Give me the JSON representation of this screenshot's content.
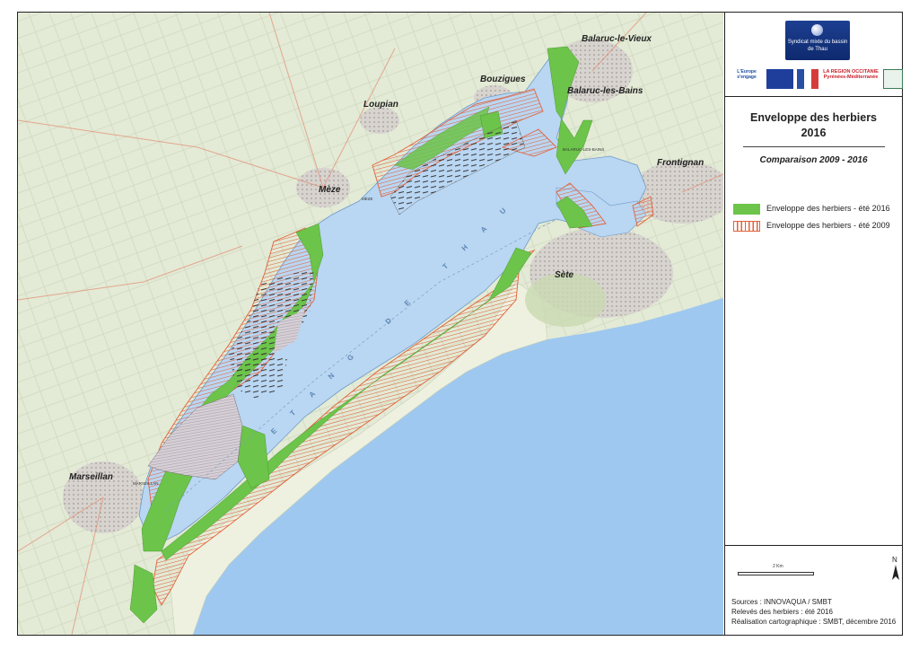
{
  "map": {
    "places": {
      "balaruc_le_vieux": "Balaruc-le-Vieux",
      "bouzigues": "Bouzigues",
      "balaruc_les_bains": "Balaruc-les-Bains",
      "loupian": "Loupian",
      "meze": "Mèze",
      "frontignan": "Frontignan",
      "sete": "Sète",
      "marseillan": "Marseillan"
    },
    "water_label": "ETANG DE THAU",
    "small_labels": {
      "meze_port": "MÈZE",
      "balaruc_port": "BALARUC-LES-BAINS",
      "marseillan_port": "MARSEILLAN"
    }
  },
  "panel": {
    "logos": {
      "main": "Syndicat mixte du bassin de Thau",
      "europe": "L'Europe s'engage",
      "region": "LA RÉGION OCCITANIE Pyrénées-Méditerranée"
    },
    "title_line1": "Enveloppe des herbiers",
    "title_line2": "2016",
    "subtitle": "Comparaison 2009 - 2016",
    "legend": [
      {
        "label": "Enveloppe des herbiers - été 2016",
        "color": "#6cc44a"
      },
      {
        "label": "Enveloppe des herbiers - été 2009",
        "color": "#e2623a"
      }
    ],
    "scale_label": "2 Km",
    "north_label": "N",
    "credits": {
      "sources": "Sources : INNOVAQUA / SMBT",
      "releves": "Relevés des herbiers : été 2016",
      "realisation": "Réalisation cartographique : SMBT, décembre 2016"
    }
  },
  "colors": {
    "lagoon": "#b9d6f2",
    "sea": "#9ec8ef",
    "land": "#dfe8d2",
    "seagrass_2016": "#6cc44a",
    "seagrass_2009": "#e2623a"
  }
}
